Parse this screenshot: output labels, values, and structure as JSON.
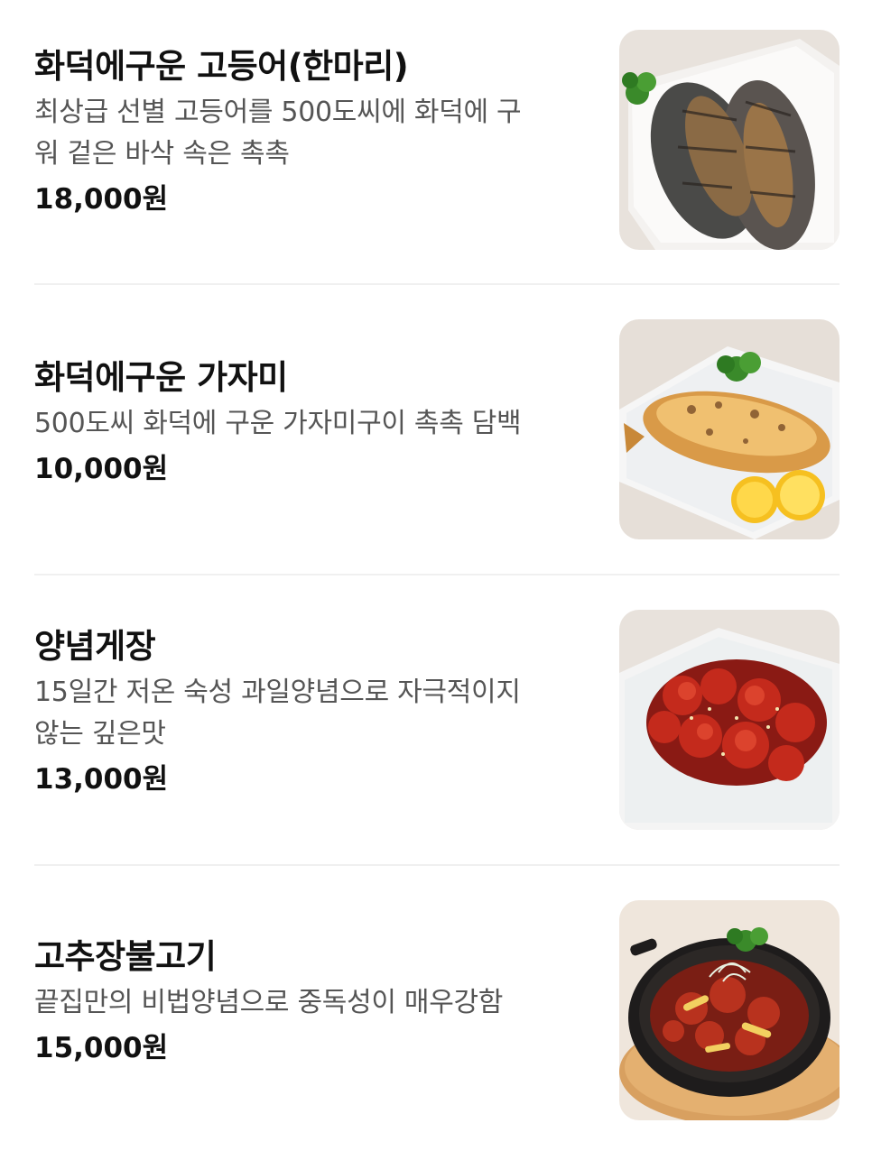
{
  "menu": [
    {
      "name": "화덕에구운 고등어(한마리)",
      "description_lines": [
        "최상급 선별 고등어를 500도씨에 화덕에 구",
        "워 겉은 바삭 속은 촉촉"
      ],
      "price": "18,000원",
      "image_icon": "grilled-mackerel-image"
    },
    {
      "name": "화덕에구운 가자미",
      "description_lines": [
        "500도씨 화덕에 구운 가자미구이 촉촉 담백"
      ],
      "price": "10,000원",
      "image_icon": "grilled-flounder-image"
    },
    {
      "name": "양념게장",
      "description_lines": [
        "15일간 저온 숙성 과일양념으로 자극적이지",
        "않는 깊은맛"
      ],
      "price": "13,000원",
      "image_icon": "seasoned-crab-image"
    },
    {
      "name": "고추장불고기",
      "description_lines": [
        "끝집만의 비법양념으로 중독성이 매우강함"
      ],
      "price": "15,000원",
      "image_icon": "gochujang-bulgogi-image"
    }
  ]
}
